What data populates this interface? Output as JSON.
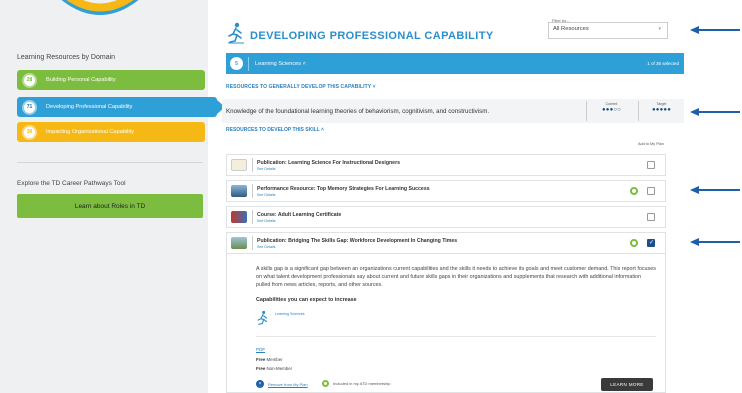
{
  "sidebar": {
    "title": "Learning Resources by Domain",
    "domains": [
      {
        "num": "28",
        "label": "Building Personal Capability"
      },
      {
        "num": "71",
        "label": "Developing Professional Capability"
      },
      {
        "num": "30",
        "label": "Impacting Organizational Capability"
      }
    ],
    "explore_title": "Explore the TD Career Pathways Tool",
    "explore_button": "Learn about Roles in TD"
  },
  "header": {
    "title": "DEVELOPING PROFESSIONAL CAPABILITY",
    "filter_label": "Filter by...",
    "filter_value": "All Resources"
  },
  "capability_bar": {
    "num": "5",
    "label": "Learning Sciences",
    "count": "1 of 36 selected"
  },
  "section_general": "RESOURCES TO GENERALLY DEVELOP THIS CAPABILITY",
  "skill": {
    "text": "Knowledge of the foundational learning theories of behaviorism, cognitivism, and constructivism.",
    "current_label": "Current",
    "current_dots": "●●●○○",
    "target_label": "Target",
    "target_dots": "●●●●●"
  },
  "section_skill": "RESOURCES TO DEVELOP THIS SKILL",
  "add_to_plan": "Add to My Plan",
  "resources": [
    {
      "title": "Publication: Learning Science For Instructional Designers",
      "see": "See Details"
    },
    {
      "title": "Performance Resource: Top Memory Strategies For Learning Success",
      "see": "See Details"
    },
    {
      "title": "Course: Adult Learning Certificate",
      "see": "See Details"
    },
    {
      "title": "Publication: Bridging The Skills Gap: Workforce Development In Changing Times",
      "see": "See Details"
    }
  ],
  "expanded": {
    "description": "A skills gap is a significant gap between an organizations current capabilities and the skills it needs to achieve its goals and meet customer demand. This report focuses on what talent development professionals say about current and future skills gaps in their organizations and supplements that research with additional information pulled from news articles, reports, and other sources.",
    "capabilities_title": "Capabilities you can expect to increase",
    "capability_name": "Learning Sciences",
    "format": "PDF",
    "price_member_bold": "Free",
    "price_member": "Member",
    "price_nonmember_bold": "Free",
    "price_nonmember": "Non-Member",
    "remove_label": "Remove from My Plan",
    "included_label": "Included in my ATD membership",
    "learn_more": "LEARN MORE"
  },
  "colors": {
    "green": "#7cbd3f",
    "blue": "#2f9fd7",
    "yellow": "#f6b814",
    "navy": "#1f4f8a"
  }
}
